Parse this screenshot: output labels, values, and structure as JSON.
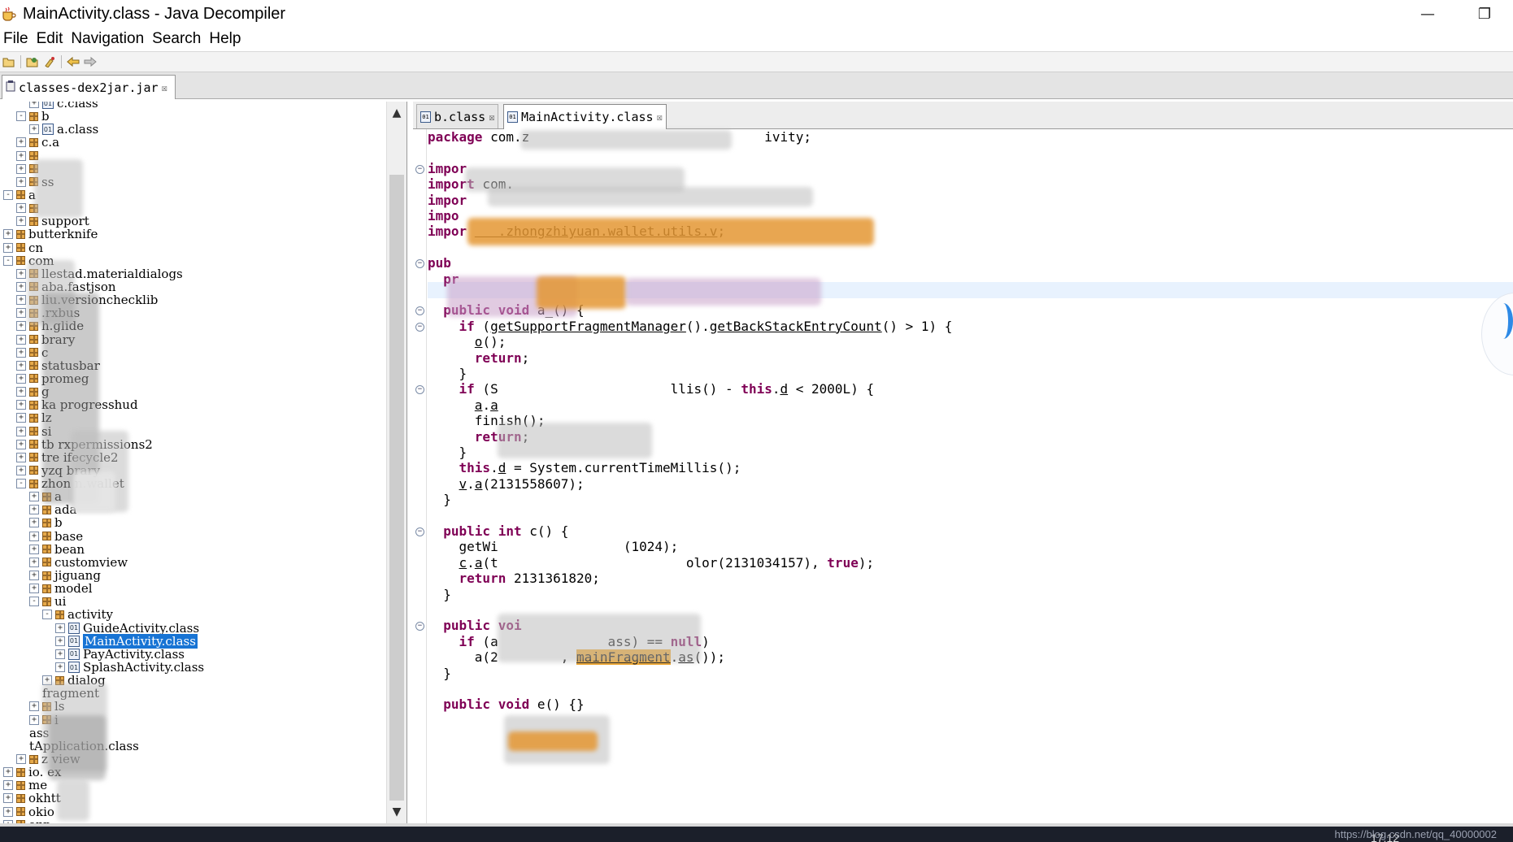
{
  "window": {
    "title": "MainActivity.class - Java Decompiler",
    "minimize_glyph": "—",
    "restore_glyph": "❐"
  },
  "menu": [
    "File",
    "Edit",
    "Navigation",
    "Search",
    "Help"
  ],
  "toolbar": {
    "icons": [
      "open-file-icon",
      "open-type-icon",
      "search-icon",
      "back-arrow-icon",
      "forward-arrow-icon"
    ]
  },
  "outer_tab": {
    "label": "classes-dex2jar.jar",
    "close": "☒"
  },
  "tree": {
    "rows": [
      {
        "indent": 2,
        "exp": "+",
        "icon": "class",
        "label": "c.class"
      },
      {
        "indent": 1,
        "exp": "-",
        "icon": "pkg",
        "label": "b"
      },
      {
        "indent": 2,
        "exp": "+",
        "icon": "class",
        "label": "a.class"
      },
      {
        "indent": 1,
        "exp": "+",
        "icon": "pkg",
        "label": "c.a"
      },
      {
        "indent": 1,
        "exp": "+",
        "icon": "pkg",
        "label": ""
      },
      {
        "indent": 1,
        "exp": "+",
        "icon": "pkg",
        "label": ""
      },
      {
        "indent": 1,
        "exp": "+",
        "icon": "pkg",
        "label": "ss"
      },
      {
        "indent": 0,
        "exp": "-",
        "icon": "pkg",
        "label": "a"
      },
      {
        "indent": 1,
        "exp": "+",
        "icon": "pkg",
        "label": ""
      },
      {
        "indent": 1,
        "exp": "+",
        "icon": "pkg",
        "label": "support"
      },
      {
        "indent": 0,
        "exp": "+",
        "icon": "pkg",
        "label": "butterknife"
      },
      {
        "indent": 0,
        "exp": "+",
        "icon": "pkg",
        "label": "cn"
      },
      {
        "indent": 0,
        "exp": "-",
        "icon": "pkg",
        "label": "com"
      },
      {
        "indent": 1,
        "exp": "+",
        "icon": "pkg",
        "label": "llestad.materialdialogs"
      },
      {
        "indent": 1,
        "exp": "+",
        "icon": "pkg",
        "label": "aba.fastjson"
      },
      {
        "indent": 1,
        "exp": "+",
        "icon": "pkg",
        "label": "liu.versionchecklib"
      },
      {
        "indent": 1,
        "exp": "+",
        "icon": "pkg",
        "label": ".rxbus"
      },
      {
        "indent": 1,
        "exp": "+",
        "icon": "pkg",
        "label": "h.glide"
      },
      {
        "indent": 1,
        "exp": "+",
        "icon": "pkg",
        "label": "brary"
      },
      {
        "indent": 1,
        "exp": "+",
        "icon": "pkg",
        "label": "c"
      },
      {
        "indent": 1,
        "exp": "+",
        "icon": "pkg",
        "label": "statusbar"
      },
      {
        "indent": 1,
        "exp": "+",
        "icon": "pkg",
        "label": "promeg"
      },
      {
        "indent": 1,
        "exp": "+",
        "icon": "pkg",
        "label": "g"
      },
      {
        "indent": 1,
        "exp": "+",
        "icon": "pkg",
        "label": "ka progresshud"
      },
      {
        "indent": 1,
        "exp": "+",
        "icon": "pkg",
        "label": "lz"
      },
      {
        "indent": 1,
        "exp": "+",
        "icon": "pkg",
        "label": "si"
      },
      {
        "indent": 1,
        "exp": "+",
        "icon": "pkg",
        "label": "tb rxpermissions2"
      },
      {
        "indent": 1,
        "exp": "+",
        "icon": "pkg",
        "label": "tre ifecycle2"
      },
      {
        "indent": 1,
        "exp": "+",
        "icon": "pkg",
        "label": "yzq brary"
      },
      {
        "indent": 1,
        "exp": "-",
        "icon": "pkg",
        "label": "zhon n.wallet"
      },
      {
        "indent": 2,
        "exp": "+",
        "icon": "pkg",
        "label": "a"
      },
      {
        "indent": 2,
        "exp": "+",
        "icon": "pkg",
        "label": "ada"
      },
      {
        "indent": 2,
        "exp": "+",
        "icon": "pkg",
        "label": "b"
      },
      {
        "indent": 2,
        "exp": "+",
        "icon": "pkg",
        "label": "base"
      },
      {
        "indent": 2,
        "exp": "+",
        "icon": "pkg",
        "label": "bean"
      },
      {
        "indent": 2,
        "exp": "+",
        "icon": "pkg",
        "label": "customview"
      },
      {
        "indent": 2,
        "exp": "+",
        "icon": "pkg",
        "label": "jiguang"
      },
      {
        "indent": 2,
        "exp": "+",
        "icon": "pkg",
        "label": "model"
      },
      {
        "indent": 2,
        "exp": "-",
        "icon": "pkg",
        "label": "ui"
      },
      {
        "indent": 3,
        "exp": "-",
        "icon": "pkg",
        "label": "activity"
      },
      {
        "indent": 4,
        "exp": "+",
        "icon": "class",
        "label": "GuideActivity.class"
      },
      {
        "indent": 4,
        "exp": "+",
        "icon": "class",
        "label": "MainActivity.class",
        "selected": true
      },
      {
        "indent": 4,
        "exp": "+",
        "icon": "class",
        "label": "PayActivity.class"
      },
      {
        "indent": 4,
        "exp": "+",
        "icon": "class",
        "label": "SplashActivity.class"
      },
      {
        "indent": 3,
        "exp": "+",
        "icon": "pkg",
        "label": "dialog"
      },
      {
        "indent": 3,
        "exp": "",
        "icon": "",
        "label": "fragment"
      },
      {
        "indent": 2,
        "exp": "+",
        "icon": "pkg",
        "label": "ls"
      },
      {
        "indent": 2,
        "exp": "+",
        "icon": "pkg",
        "label": "i"
      },
      {
        "indent": 2,
        "exp": "",
        "icon": "",
        "label": "ass"
      },
      {
        "indent": 2,
        "exp": "",
        "icon": "",
        "label": "tApplication.class"
      },
      {
        "indent": 1,
        "exp": "+",
        "icon": "pkg",
        "label": "z view"
      },
      {
        "indent": 0,
        "exp": "+",
        "icon": "pkg",
        "label": "io. ex"
      },
      {
        "indent": 0,
        "exp": "+",
        "icon": "pkg",
        "label": "me"
      },
      {
        "indent": 0,
        "exp": "+",
        "icon": "pkg",
        "label": "okhtt"
      },
      {
        "indent": 0,
        "exp": "+",
        "icon": "pkg",
        "label": "okio"
      },
      {
        "indent": 0,
        "exp": "+",
        "icon": "pkg",
        "label": "org"
      }
    ],
    "scroll_up": "▲",
    "scroll_down": "▼"
  },
  "editor": {
    "tabs": [
      {
        "label": "b.class",
        "close": "☒",
        "active": false
      },
      {
        "label": "MainActivity.class",
        "close": "☒",
        "active": true
      }
    ],
    "lines": [
      {
        "fold": "",
        "html": "<span class='kw'>package</span> com.z                              ivity;"
      },
      {
        "fold": "",
        "html": ""
      },
      {
        "fold": "⊖",
        "html": "<span class='kw'>impor</span>"
      },
      {
        "fold": "",
        "html": "<span class='kw'>import</span> com."
      },
      {
        "fold": "",
        "html": "<span class='kw'>impor</span>"
      },
      {
        "fold": "",
        "html": "<span class='kw'>impo</span>"
      },
      {
        "fold": "",
        "html": "<span class='kw'>impor</span> <span class='ul'>   .zhongzhiyuan.wallet.utils.v</span>;"
      },
      {
        "fold": "",
        "html": ""
      },
      {
        "fold": "⊖",
        "html": "<span class='kw'>pub</span>"
      },
      {
        "fold": "",
        "html": "  <span class='kw'>pr</span>"
      },
      {
        "fold": "",
        "html": ""
      },
      {
        "fold": "⊖",
        "html": "  <span class='kw'>public</span> <span class='kw'>void</span> a_() {"
      },
      {
        "fold": "⊖",
        "html": "    <span class='kw'>if</span> (<span class='ul'>getSupportFragmentManager</span>().<span class='ul'>getBackStackEntryCount</span>() &gt; 1) {"
      },
      {
        "fold": "",
        "html": "      <span class='ul'>o</span>();"
      },
      {
        "fold": "",
        "html": "      <span class='kw'>return</span>;"
      },
      {
        "fold": "",
        "html": "    }"
      },
      {
        "fold": "⊖",
        "html": "    <span class='kw'>if</span> (S                      llis() - <span class='kw'>this</span>.<span class='ul'>d</span> &lt; 2000L) {"
      },
      {
        "fold": "",
        "html": "      <span class='ul'>a</span>.<span class='ul'>a</span>"
      },
      {
        "fold": "",
        "html": "      finish();"
      },
      {
        "fold": "",
        "html": "      <span class='kw'>return</span>;"
      },
      {
        "fold": "",
        "html": "    }"
      },
      {
        "fold": "",
        "html": "    <span class='kw'>this</span>.<span class='ul'>d</span> = System.currentTimeMillis();"
      },
      {
        "fold": "",
        "html": "    <span class='ul'>v</span>.<span class='ul'>a</span>(2131558607);"
      },
      {
        "fold": "",
        "html": "  }"
      },
      {
        "fold": "",
        "html": ""
      },
      {
        "fold": "⊖",
        "html": "  <span class='kw'>public</span> <span class='kw'>int</span> c() {"
      },
      {
        "fold": "",
        "html": "    getWi                (1024);"
      },
      {
        "fold": "",
        "html": "    <span class='ul'>c</span>.<span class='ul'>a</span>(t                        olor(2131034157), <span class='kw'>true</span>);"
      },
      {
        "fold": "",
        "html": "    <span class='kw'>return</span> 2131361820;"
      },
      {
        "fold": "",
        "html": "  }"
      },
      {
        "fold": "",
        "html": ""
      },
      {
        "fold": "⊖",
        "html": "  <span class='kw'>public</span> <span class='kw'>voi</span>"
      },
      {
        "fold": "",
        "html": "    <span class='kw'>if</span> (a              ass) == <span class='kw'>null</span>)"
      },
      {
        "fold": "",
        "html": "      a(2        , <span class='hl-occ ul'>mainFragment</span>.<span class='ul'>as</span>());"
      },
      {
        "fold": "",
        "html": "  }"
      },
      {
        "fold": "",
        "html": ""
      },
      {
        "fold": "",
        "html": "  <span class='kw'>public</span> <span class='kw'>void</span> e() {}"
      }
    ]
  },
  "taskbar": {
    "clock": "17:12",
    "watermark": "https://blog.csdn.net/qq_40000002"
  }
}
